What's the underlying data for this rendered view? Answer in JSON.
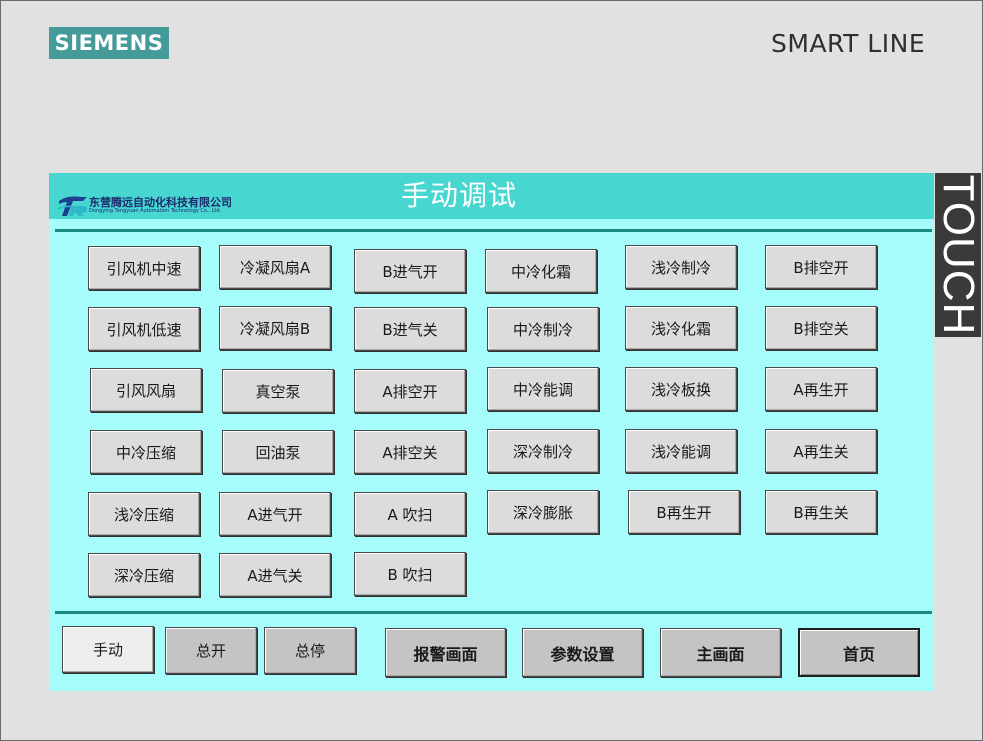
{
  "header": {
    "brand": "SIEMENS",
    "model": "SMART LINE",
    "side_label": "TOUCH"
  },
  "screen": {
    "title": "手动调试",
    "company": {
      "name_cn": "东营腾远自动化科技有限公司",
      "name_en": "Dongying Tengyuan Automation Technology Co., Ltd."
    }
  },
  "buttons": {
    "r1c1": "引风机中速",
    "r1c2": "冷凝风扇A",
    "r1c3": "B进气开",
    "r1c4": "中冷化霜",
    "r1c5": "浅冷制冷",
    "r1c6": "B排空开",
    "r2c1": "引风机低速",
    "r2c2": "冷凝风扇B",
    "r2c3": "B进气关",
    "r2c4": "中冷制冷",
    "r2c5": "浅冷化霜",
    "r2c6": "B排空关",
    "r3c1": "引风风扇",
    "r3c2": "真空泵",
    "r3c3": "A排空开",
    "r3c4": "中冷能调",
    "r3c5": "浅冷板换",
    "r3c6": "A再生开",
    "r4c1": "中冷压缩",
    "r4c2": "回油泵",
    "r4c3": "A排空关",
    "r4c4": "深冷制冷",
    "r4c5": "浅冷能调",
    "r4c6": "A再生关",
    "r5c1": "浅冷压缩",
    "r5c2": "A进气开",
    "r5c3": "A 吹扫",
    "r5c4": "深冷膨胀",
    "r5c5": "B再生开",
    "r5c6": "B再生关",
    "r6c1": "深冷压缩",
    "r6c2": "A进气关",
    "r6c3": "B 吹扫"
  },
  "footer": {
    "manual": "手动",
    "all_on": "总开",
    "all_stop": "总停",
    "alarm_screen": "报警画面",
    "parameter_settings": "参数设置",
    "main_screen": "主画面",
    "home": "首页"
  },
  "colors": {
    "bezel": "#e1e1e1",
    "siemens_teal": "#459a9a",
    "screen_background": "#a6fbfb",
    "title_bar": "#48d6d0",
    "divider": "#1a8a82",
    "button_face": "#dcdcdc"
  }
}
